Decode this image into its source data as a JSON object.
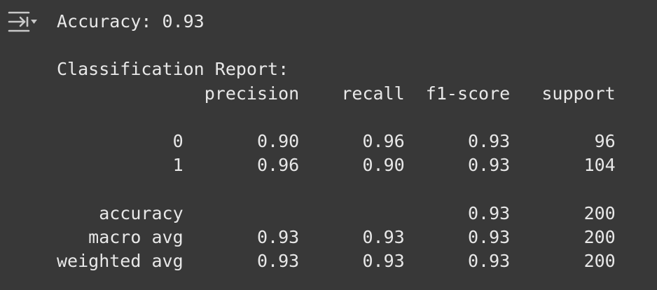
{
  "output": {
    "toggle_icon": "output-collapse-icon",
    "lines": [
      "Accuracy: 0.93",
      "",
      "Classification Report:",
      "              precision    recall  f1-score   support",
      "",
      "           0       0.90      0.96      0.93        96",
      "           1       0.96      0.90      0.93       104",
      "",
      "    accuracy                           0.93       200",
      "   macro avg       0.93      0.93      0.93       200",
      "weighted avg       0.93      0.93      0.93       200"
    ]
  },
  "colors": {
    "background": "#383838",
    "text": "#e8e8e8",
    "icon": "#c8c8c8"
  }
}
